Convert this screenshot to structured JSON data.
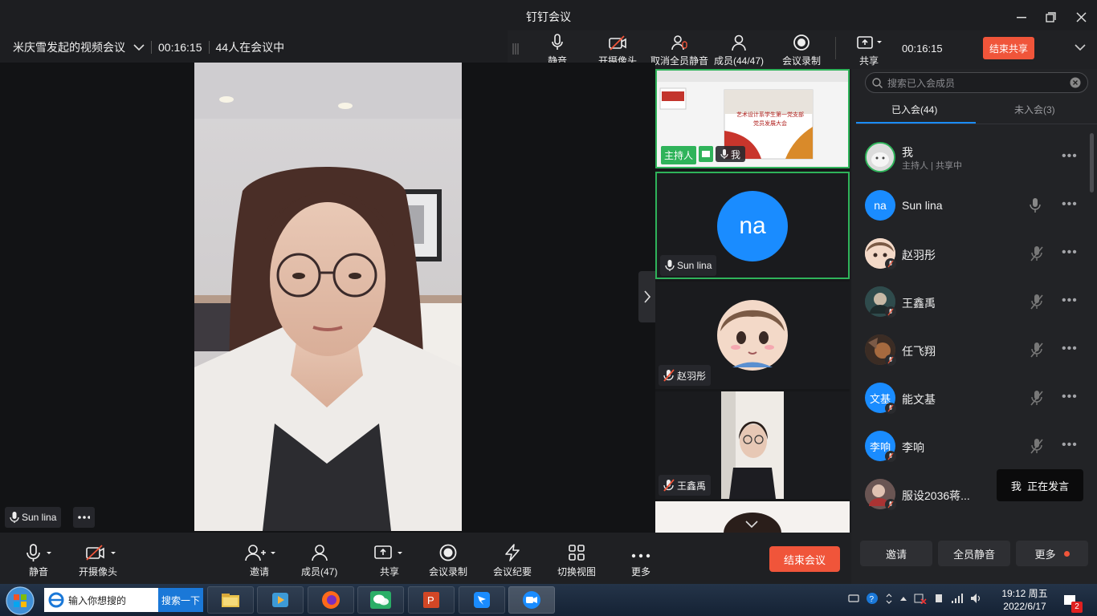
{
  "window": {
    "title": "钉钉会议",
    "meeting_name": "米庆雪发起的视频会议",
    "elapsed": "00:16:15",
    "participants_status": "44人在会议中"
  },
  "top_toolbar": {
    "mute": "静音",
    "camera": "开摄像头",
    "unmute_all": "取消全员静音",
    "members": "成员(44/47)",
    "record": "会议录制",
    "share": "共享",
    "timer": "00:16:15",
    "end_share": "结束共享"
  },
  "main_video": {
    "speaker_name": "Sun lina"
  },
  "thumbnails": [
    {
      "type": "screen",
      "slide_title": "艺术设计系学生第一党支部",
      "slide_subtitle": "党员发展大会",
      "host_tag": "主持人",
      "name": "我"
    },
    {
      "type": "initials",
      "initials": "na",
      "name": "Sun lina",
      "avatar_color": "#1a8cff"
    },
    {
      "type": "avatar",
      "name": "赵羽彤"
    },
    {
      "type": "video",
      "name": "王鑫禹"
    }
  ],
  "panel": {
    "search_placeholder": "搜索已入会成员",
    "tab_joined": "已入会(44)",
    "tab_not_joined": "未入会(3)",
    "members": [
      {
        "name": "我",
        "sub": "主持人 | 共享中",
        "avatar": "photo"
      },
      {
        "name": "Sun lina",
        "avatar_text": "na",
        "mic": "on"
      },
      {
        "name": "赵羽彤",
        "avatar": "anime",
        "mic": "muted"
      },
      {
        "name": "王鑫禹",
        "avatar": "photo",
        "mic": "muted"
      },
      {
        "name": "任飞翔",
        "avatar": "photo",
        "mic": "muted"
      },
      {
        "name": "能文基",
        "avatar_text": "文基",
        "mic": "muted"
      },
      {
        "name": "李响",
        "avatar_text": "李响",
        "mic": "muted"
      },
      {
        "name": "服设2036蒋...",
        "avatar": "photo",
        "mic": "muted"
      }
    ],
    "invite": "邀请",
    "mute_all": "全员静音",
    "more": "更多",
    "speaking_toast": "我  正在发言"
  },
  "bottom_toolbar": {
    "mute": "静音",
    "camera": "开摄像头",
    "invite": "邀请",
    "members": "成员(47)",
    "share": "共享",
    "record": "会议录制",
    "minutes": "会议纪要",
    "view": "切换视图",
    "more": "更多",
    "end_meeting": "结束会议"
  },
  "taskbar": {
    "search_placeholder": "输入你想搜的",
    "search_button": "搜索一下",
    "time": "19:12 周五",
    "date": "2022/6/17",
    "notification_count": "2"
  },
  "colors": {
    "accent_red": "#f0553a",
    "active_green": "#2fb35a",
    "blue": "#1a8cff"
  }
}
